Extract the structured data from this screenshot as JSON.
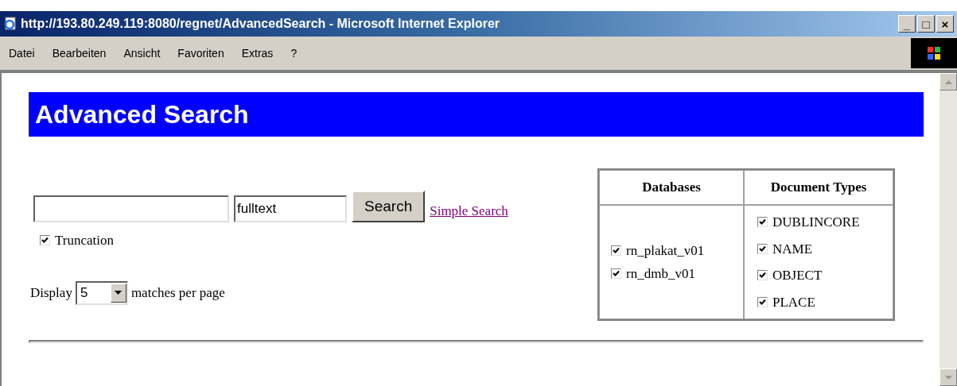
{
  "window": {
    "title": "http://193.80.249.119:8080/regnet/AdvancedSearch - Microsoft Internet Explorer",
    "controls": [
      "_",
      "□",
      "×"
    ]
  },
  "menu": [
    "Datei",
    "Bearbeiten",
    "Ansicht",
    "Favoriten",
    "Extras",
    "?"
  ],
  "page": {
    "heading": "Advanced Search",
    "field": {
      "value": "fulltext"
    },
    "search_button": "Search",
    "simple_search_link": "Simple Search",
    "truncation": {
      "label": "Truncation",
      "checked": true
    },
    "display": {
      "label": "Display",
      "value": "5",
      "suffix": "matches per page"
    },
    "table": {
      "columns": [
        "Databases",
        "Document Types"
      ],
      "databases": [
        {
          "label": "rn_plakat_v01",
          "checked": true
        },
        {
          "label": "rn_dmb_v01",
          "checked": true
        }
      ],
      "document_types": [
        {
          "label": "DUBLINCORE",
          "checked": true
        },
        {
          "label": "NAME",
          "checked": true
        },
        {
          "label": "OBJECT",
          "checked": true
        },
        {
          "label": "PLACE",
          "checked": true
        }
      ]
    }
  }
}
